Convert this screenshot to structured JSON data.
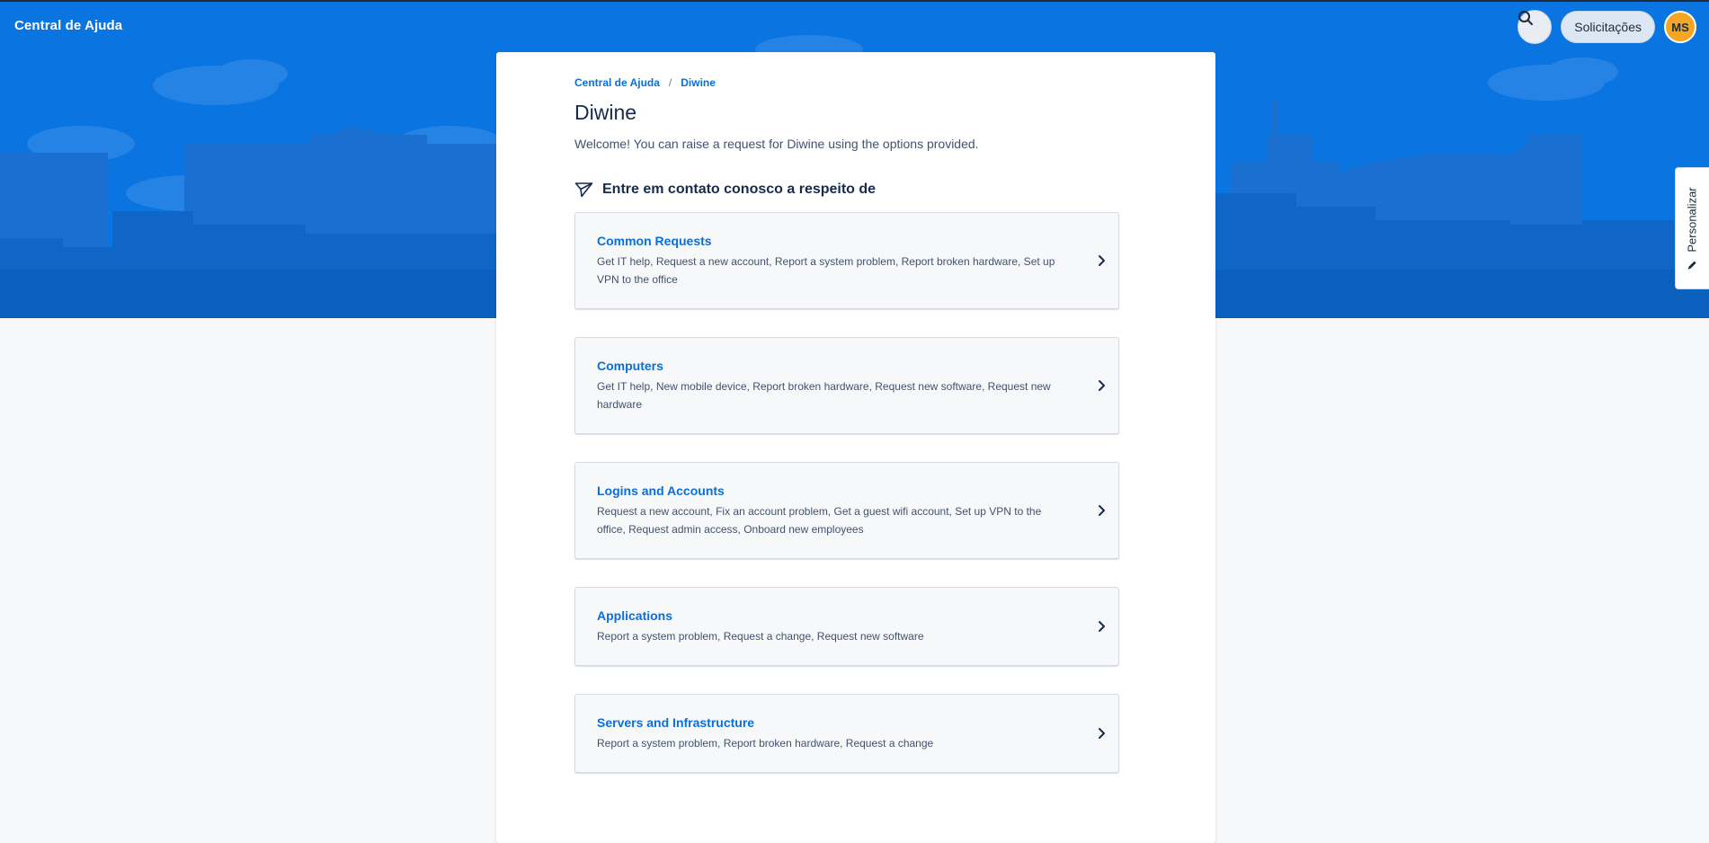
{
  "header": {
    "brand": "Central de Ajuda",
    "requests_label": "Solicitações",
    "avatar_initials": "MS"
  },
  "personalize": {
    "label": "Personalizar"
  },
  "breadcrumb": {
    "home": "Central de Ajuda",
    "separator": "/",
    "current": "Diwine"
  },
  "page": {
    "title": "Diwine",
    "welcome": "Welcome! You can raise a request for Diwine using the options provided.",
    "section_heading": "Entre em contato conosco a respeito de"
  },
  "request_types": [
    {
      "title": "Common Requests",
      "description": "Get IT help, Request a new account, Report a system problem, Report broken hardware, Set up VPN to the office"
    },
    {
      "title": "Computers",
      "description": "Get IT help, New mobile device, Report broken hardware, Request new software, Request new hardware"
    },
    {
      "title": "Logins and Accounts",
      "description": "Request a new account, Fix an account problem, Get a guest wifi account, Set up VPN to the office, Request admin access, Onboard new employees"
    },
    {
      "title": "Applications",
      "description": "Report a system problem, Request a change, Request new software"
    },
    {
      "title": "Servers and Infrastructure",
      "description": "Report a system problem, Report broken hardware, Request a change"
    }
  ],
  "icons": {
    "search": "search-icon",
    "send": "paper-plane-icon",
    "chevron": "chevron-right-icon",
    "pencil": "pencil-icon"
  },
  "colors": {
    "hero_blue": "#0a74e0",
    "link_blue": "#0a6fd6",
    "avatar_orange": "#f5a623"
  }
}
